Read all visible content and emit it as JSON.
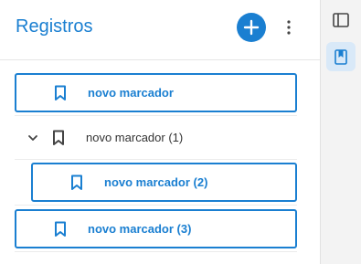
{
  "header": {
    "title": "Registros",
    "add_icon": "plus-icon",
    "more_icon": "more-vertical-icon"
  },
  "bookmarks": [
    {
      "label": "novo marcador",
      "selected": true,
      "level": 0
    },
    {
      "label": "novo marcador (1)",
      "selected": false,
      "level": 0,
      "expanded": true
    },
    {
      "label": "novo marcador (2)",
      "selected": true,
      "level": 1
    },
    {
      "label": "novo marcador (3)",
      "selected": true,
      "level": 0
    }
  ],
  "rail": {
    "items": [
      {
        "icon": "sidebar-panel-icon",
        "active": false
      },
      {
        "icon": "bookmark-book-icon",
        "active": true
      }
    ]
  },
  "colors": {
    "accent": "#1a7fd1",
    "rail_background": "#f3f3f3",
    "rail_active": "#d9e9f8"
  }
}
